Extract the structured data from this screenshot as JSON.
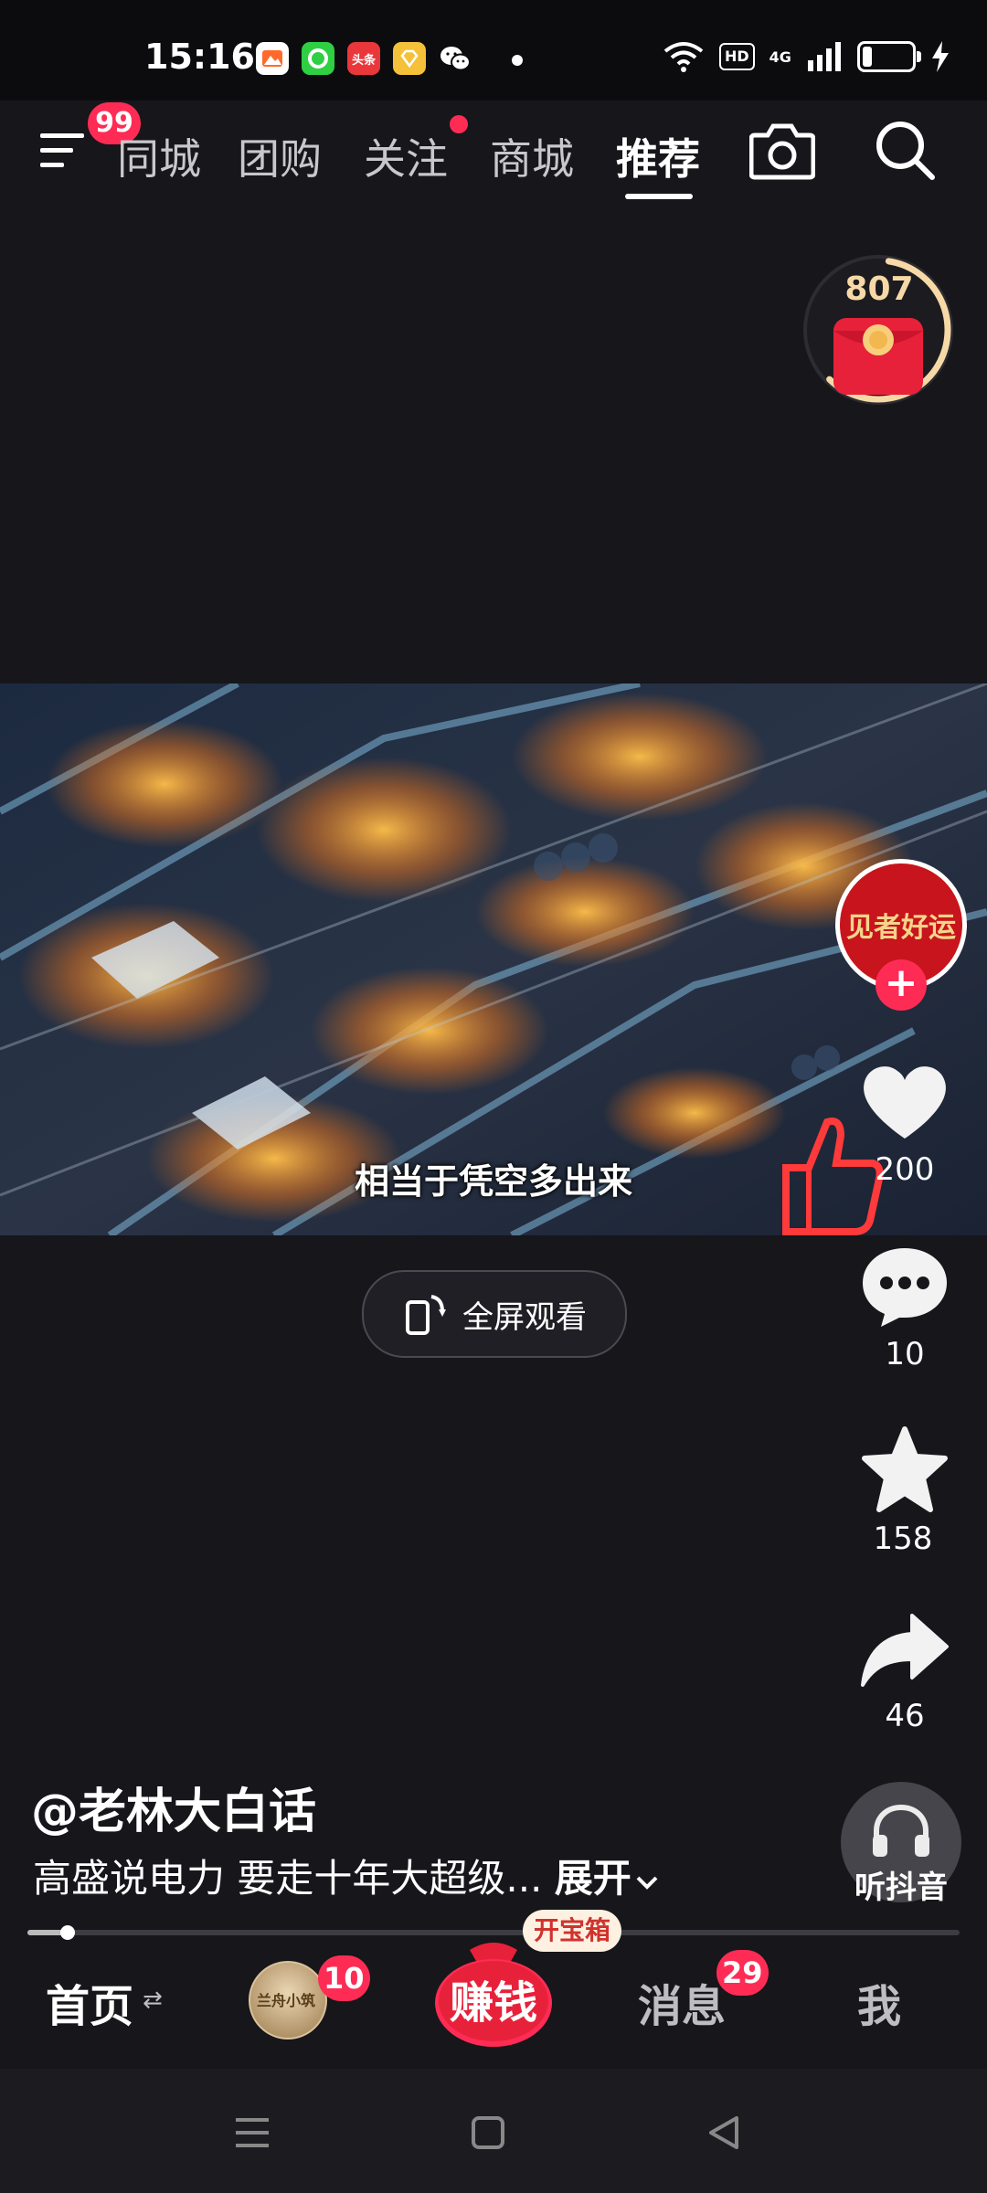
{
  "status_bar": {
    "time": "15:16",
    "app_icons": [
      "photos-app-icon",
      "chat-bubble-app-icon",
      "toutiao-app-icon",
      "diamond-app-icon",
      "wechat-icon"
    ],
    "toutiao_label": "头条",
    "hd_label": "HD",
    "network_label": "4G",
    "battery_level": 0.15
  },
  "top_nav": {
    "menu_badge": "99",
    "tabs": [
      {
        "label": "同城",
        "active": false
      },
      {
        "label": "团购",
        "active": false
      },
      {
        "label": "关注",
        "active": false
      },
      {
        "label": "商城",
        "active": false
      },
      {
        "label": "推荐",
        "active": true
      }
    ],
    "follow_has_dot": true
  },
  "reward_widget": {
    "count": "807",
    "progress": 0.6
  },
  "video": {
    "subtitle": "相当于凭空多出来",
    "fullscreen_label": "全屏观看"
  },
  "right_rail": {
    "avatar_text": "见者好运",
    "like_count": "200",
    "comment_count": "10",
    "favorite_count": "158",
    "share_count": "46",
    "listen_label": "听抖音"
  },
  "caption": {
    "author": "@老林大白话",
    "description": "高盛说电力 要走十年大超级...",
    "expand_label": "展开"
  },
  "playback": {
    "progress": 0.04
  },
  "bottom_tabs": {
    "home_label": "首页",
    "shop_badge": "10",
    "shop_avatar_text": "兰舟小筑",
    "earn_label": "赚钱",
    "treasure_label": "开宝箱",
    "messages_label": "消息",
    "messages_badge": "29",
    "me_label": "我"
  },
  "colors": {
    "accent": "#fe2c55",
    "background": "#16161b",
    "gold": "#f6d9a6"
  }
}
